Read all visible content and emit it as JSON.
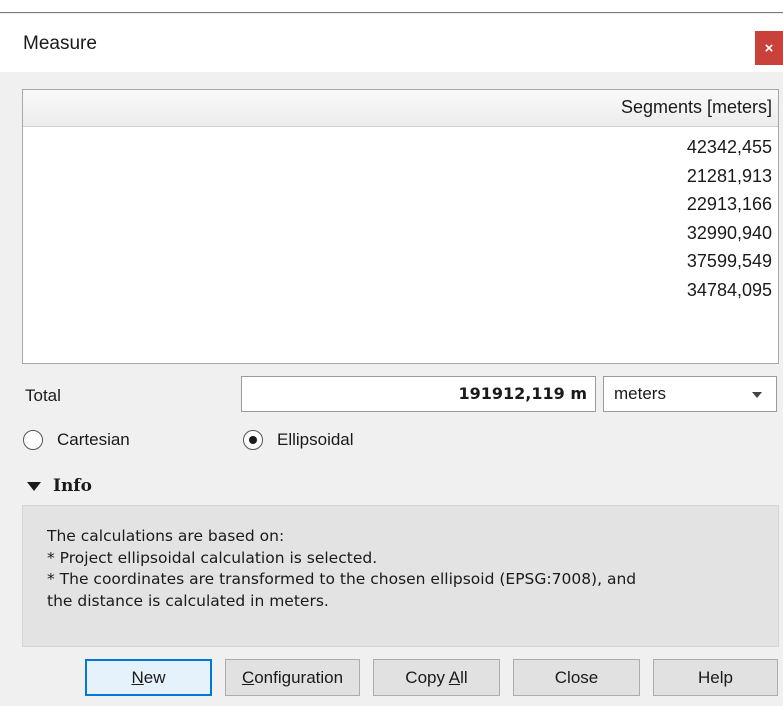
{
  "dialog": {
    "title": "Measure",
    "close_glyph": "×"
  },
  "table": {
    "header": "Segments [meters]",
    "rows": [
      "42342,455",
      "21281,913",
      "22913,166",
      "32990,940",
      "37599,549",
      "34784,095"
    ]
  },
  "total": {
    "label": "Total",
    "value": "191912,119 m",
    "unit": "meters"
  },
  "mode": {
    "cartesian": "Cartesian",
    "ellipsoidal": "Ellipsoidal",
    "selected": "Ellipsoidal"
  },
  "info": {
    "heading": "Info",
    "lines": [
      "The calculations are based on:",
      "* Project ellipsoidal calculation is selected.",
      "* The coordinates are transformed to the chosen ellipsoid (EPSG:7008), and",
      "the distance is calculated in meters."
    ]
  },
  "buttons": {
    "new_pre": "",
    "new_u": "N",
    "new_post": "ew",
    "config_pre": "",
    "config_u": "C",
    "config_post": "onfiguration",
    "copy_pre": "Copy ",
    "copy_u": "A",
    "copy_post": "ll",
    "close": "Close",
    "help": "Help"
  },
  "colors": {
    "accent": "#0078d7",
    "close_bg": "#c9413a"
  }
}
